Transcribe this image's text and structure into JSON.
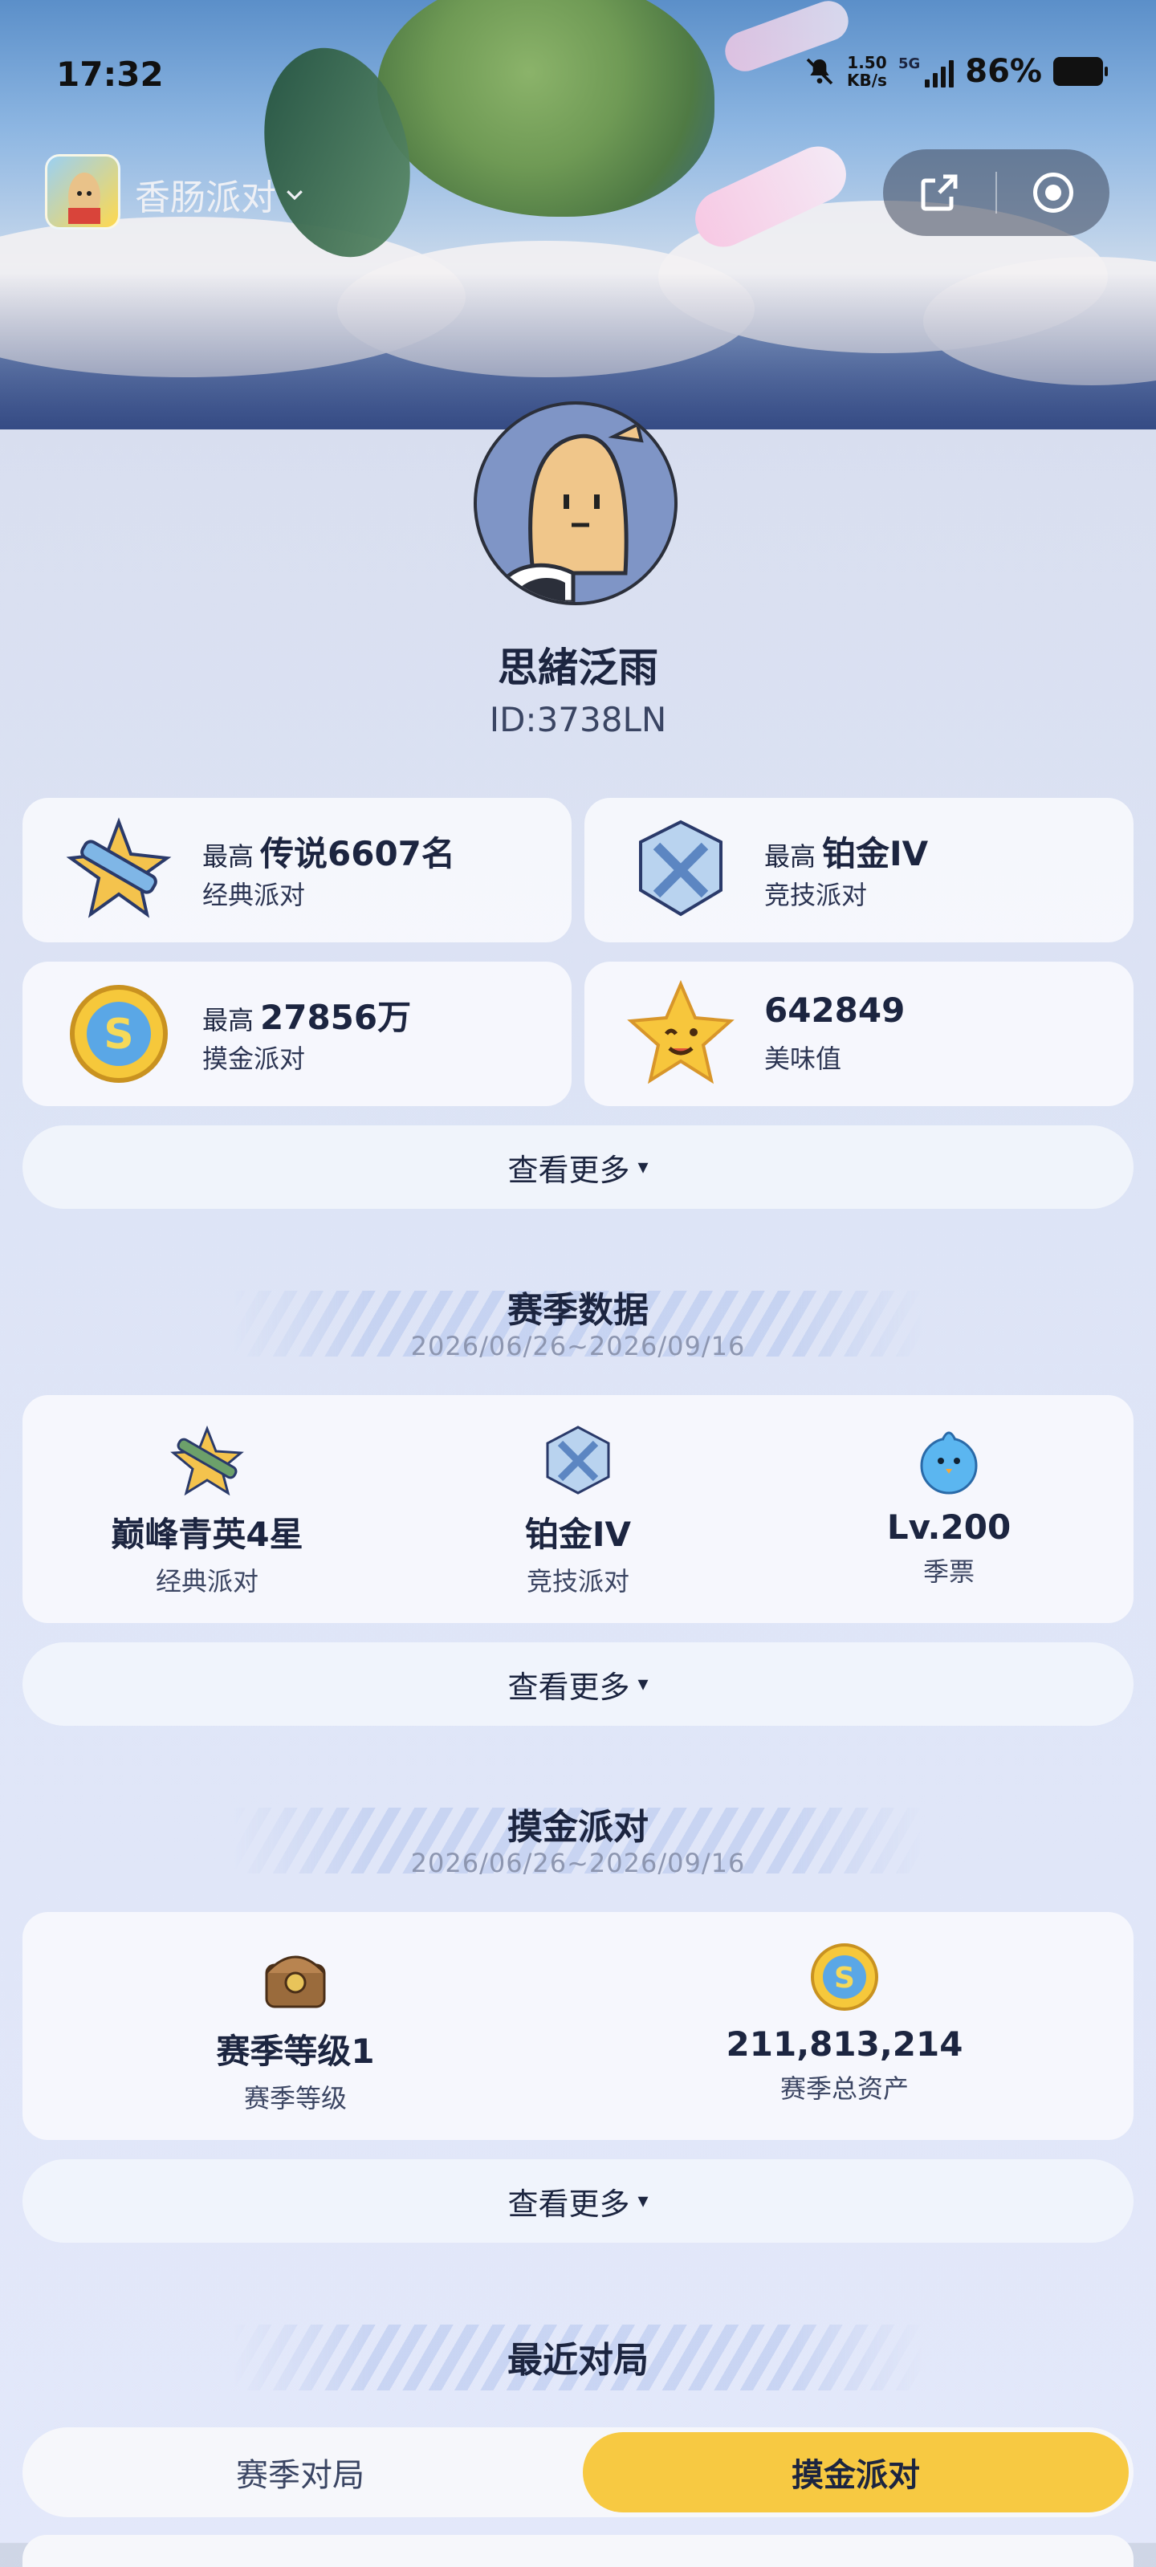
{
  "status_bar": {
    "time": "17:32",
    "net_speed_value": "1.50",
    "net_speed_unit": "KB/s",
    "network": "5G",
    "battery": "86%"
  },
  "app": {
    "title": "香肠派对",
    "share_icon": "share-icon",
    "close_icon": "target-icon"
  },
  "profile": {
    "nickname": "思緒泛雨",
    "id": "ID:3738LN"
  },
  "stats": [
    {
      "prefix": "最高",
      "value": "传说6607名",
      "label": "经典派对",
      "icon": "classic-rank-icon"
    },
    {
      "prefix": "最高",
      "value": "铂金IV",
      "label": "竞技派对",
      "icon": "platinum-rank-icon"
    },
    {
      "prefix": "最高",
      "value": "27856万",
      "label": "摸金派对",
      "icon": "gold-coin-icon"
    },
    {
      "prefix": "",
      "value": "642849",
      "label": "美味值",
      "icon": "star-face-icon"
    }
  ],
  "more_label": "查看更多",
  "caret": "▾",
  "season": {
    "title": "赛季数据",
    "date": "2026/06/26~2026/09/16",
    "items": [
      {
        "value": "巅峰青英4星",
        "label": "经典派对"
      },
      {
        "value": "铂金IV",
        "label": "竞技派对"
      },
      {
        "value": "Lv.200",
        "label": "季票"
      }
    ]
  },
  "mojin": {
    "title": "摸金派对",
    "date": "2026/06/26~2026/09/16",
    "items": [
      {
        "value": "赛季等级1",
        "label": "赛季等级"
      },
      {
        "value": "211,813,214",
        "label": "赛季总资产"
      }
    ]
  },
  "recent": {
    "title": "最近对局",
    "tabs": [
      "赛季对局",
      "摸金派对"
    ],
    "active_tab": 1
  },
  "colors": {
    "accent": "#f7c942",
    "text": "#1c2540",
    "muted": "#8d96b0"
  }
}
